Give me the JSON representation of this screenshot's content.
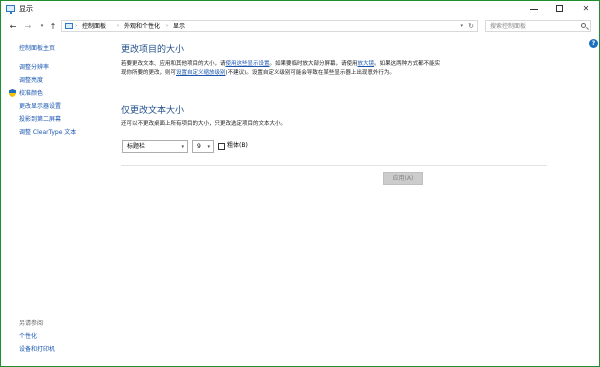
{
  "window": {
    "title": "显示",
    "accent": "#1e8f2e"
  },
  "address": {
    "crumbs": [
      "控制面板",
      "外观和个性化",
      "显示"
    ],
    "search_placeholder": "搜索控制面板"
  },
  "help_label": "?",
  "sidebar": {
    "home": "控制面板主页",
    "links": [
      "调整分辨率",
      "调整亮度",
      "校准颜色",
      "更改显示器设置",
      "投影到第二屏幕",
      "调整 ClearType 文本"
    ],
    "see_also_title": "另请参阅",
    "see_also": [
      "个性化",
      "设备和打印机"
    ]
  },
  "main": {
    "section1_title": "更改项目的大小",
    "section1_p1": "若要更改文本、应用和其他项目的大小，请",
    "section1_link1": "使用这些显示设置",
    "section1_p2": "。如果要临时放大部分屏幕，请使用",
    "section1_link2": "放大镜",
    "section1_p3": "。如果这两种方式都不能实现你所要的更改，则可",
    "section1_link3": "设置自定义缩放级别",
    "section1_p4": "(不建议)。设置自定义级别可能会导致在某些显示器上出现意外行为。",
    "section2_title": "仅更改文本大小",
    "section2_desc": "还可以不更改桌面上所有项目的大小，只更改选定项目的文本大小。",
    "item_select": "标题栏",
    "size_select": "9",
    "bold_label": "粗体(B)",
    "bold_checked": false,
    "apply_label": "应用(A)"
  }
}
